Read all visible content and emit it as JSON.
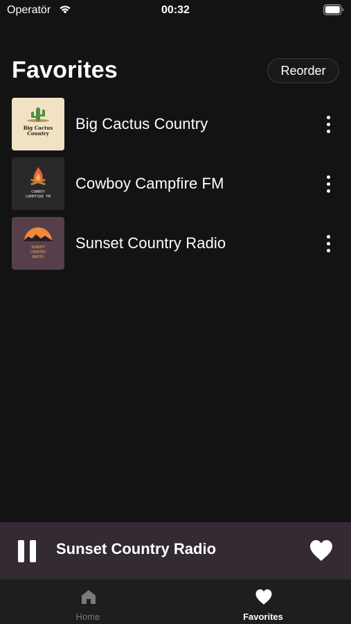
{
  "status_bar": {
    "carrier": "Operatör",
    "time": "00:32"
  },
  "header": {
    "title": "Favorites",
    "reorder_label": "Reorder"
  },
  "favorites": [
    {
      "name": "Big Cactus Country",
      "artwork_text": [
        "Big Cactus",
        "Country"
      ],
      "artwork_icon": "cactus-icon",
      "artwork_bg": "#f2e2c4"
    },
    {
      "name": "Cowboy Campfire FM",
      "artwork_text": [
        "COWBOY",
        "CAMPFIRE FM"
      ],
      "artwork_icon": "campfire-icon",
      "artwork_bg": "#2a2929"
    },
    {
      "name": "Sunset Country Radio",
      "artwork_text": [
        "SUNSET",
        "COUNTRY",
        "RADIO"
      ],
      "artwork_icon": "sunset-icon",
      "artwork_bg": "#563f4b"
    }
  ],
  "mini_player": {
    "title": "Sunset Country Radio",
    "state_icon": "pause-icon",
    "favorite_icon": "heart-icon"
  },
  "tab_bar": {
    "tabs": [
      {
        "label": "Home",
        "icon": "home-icon",
        "selected": false
      },
      {
        "label": "Favorites",
        "icon": "heart-icon",
        "selected": true
      }
    ]
  },
  "colors": {
    "background": "#141314",
    "mini_player_bg": "#332a33",
    "tab_inactive": "#7b797b",
    "tab_active": "#ffffff"
  }
}
